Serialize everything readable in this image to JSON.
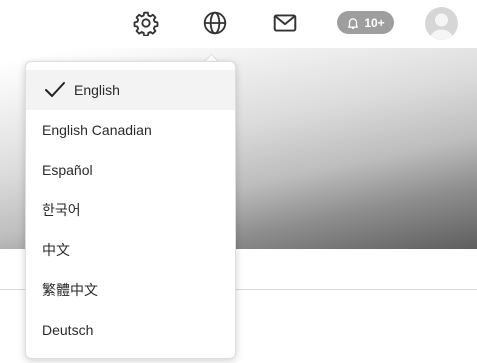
{
  "header": {
    "icons": [
      "gear-icon",
      "globe-icon",
      "mail-icon"
    ],
    "notifications": {
      "count_label": "10+",
      "icon": "bell-icon"
    }
  },
  "language_menu": {
    "selected": "English",
    "items": [
      {
        "label": "English",
        "selected": true
      },
      {
        "label": "English Canadian"
      },
      {
        "label": "Español"
      },
      {
        "label": "한국어"
      },
      {
        "label": "中文"
      },
      {
        "label": "繁體中文"
      },
      {
        "label": "Deutsch"
      }
    ]
  }
}
